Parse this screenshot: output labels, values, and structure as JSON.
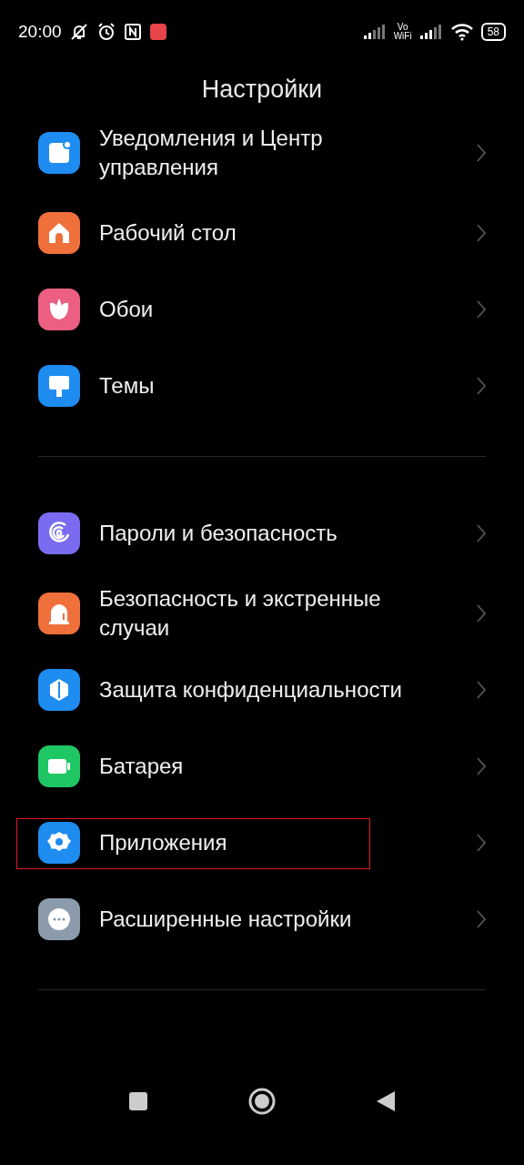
{
  "status_bar": {
    "time": "20:00",
    "volte": [
      "Vo",
      "WiFi"
    ],
    "battery": "58"
  },
  "title": "Настройки",
  "groups": [
    {
      "items": [
        {
          "label": "Уведомления и Центр управления",
          "kind": "notification",
          "color": "#1e8cf0",
          "highlighted": false
        },
        {
          "label": "Рабочий стол",
          "kind": "home",
          "color": "#f0703c",
          "highlighted": false
        },
        {
          "label": "Обои",
          "kind": "flower",
          "color": "#ec5f82",
          "highlighted": false
        },
        {
          "label": "Темы",
          "kind": "brush",
          "color": "#1e8cf0",
          "highlighted": false
        }
      ]
    },
    {
      "items": [
        {
          "label": "Пароли и безопасность",
          "kind": "fingerprint",
          "color": "#7a6cf0",
          "highlighted": false
        },
        {
          "label": "Безопасность и экстренные случаи",
          "kind": "beacon",
          "color": "#f0703c",
          "highlighted": false
        },
        {
          "label": "Защита конфиденциальности",
          "kind": "shield",
          "color": "#1e8cf0",
          "highlighted": false
        },
        {
          "label": "Батарея",
          "kind": "battery",
          "color": "#1fc764",
          "highlighted": false
        },
        {
          "label": "Приложения",
          "kind": "gear",
          "color": "#1e8cf0",
          "highlighted": true
        },
        {
          "label": "Расширенные настройки",
          "kind": "more",
          "color": "#8b9bab",
          "highlighted": false
        }
      ]
    }
  ]
}
